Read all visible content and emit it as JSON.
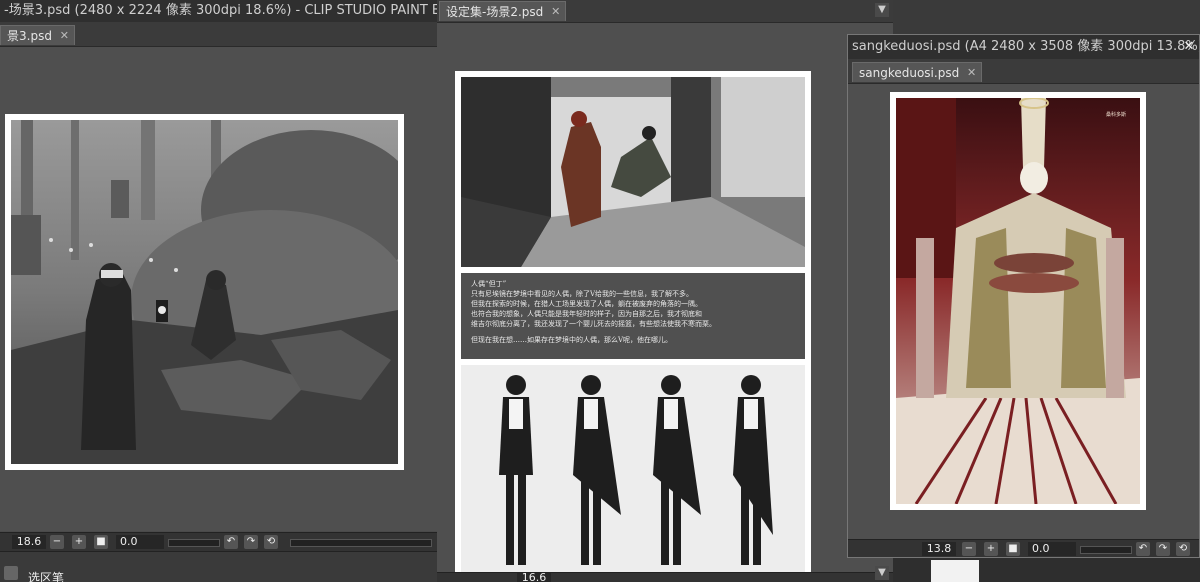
{
  "windows": {
    "left": {
      "title": "-场景3.psd (2480 x 2224 像素 300dpi 18.6%) - CLIP STUDIO PAINT EX",
      "tab": "景3.psd",
      "zoom": "18.6",
      "angle": "0.0",
      "bottom_panel_label": "选区笔"
    },
    "middle": {
      "tab": "设定集-场景2.psd",
      "zoom": "16.6",
      "text_lines": [
        "人偶“但丁”",
        "只有尼埃镜在梦境中看见的人偶，除了V给我的一些信息，我了解不多。",
        "但我在探索的时候，在猎人工场里发现了人偶，躺在被废弃的角落的一隅。",
        "也符合我的想象，人偶只能是我年轻时的样子，因为自那之后，我才彻底和",
        "维吉尔彻底分离了，我还发现了一个婴儿死去的摇篮，有些想法使我不寒而栗。",
        "",
        "但现在我在想……如果存在梦境中的人偶，那么V呢，他在哪儿。"
      ]
    },
    "right": {
      "title": "sangkeduosi.psd (A4 2480 x 3508 像素 300dpi 13.8%)",
      "tab": "sangkeduosi.psd",
      "zoom": "13.8",
      "angle": "0.0",
      "signature": "桑科多斯"
    }
  },
  "icons": {
    "close": "close-icon",
    "zoom_out": "zoom-out-icon",
    "zoom_in": "zoom-in-icon",
    "fit": "fit-icon",
    "rotate_left": "rotate-left-icon",
    "rotate_right": "rotate-right-icon",
    "reset": "reset-rotation-icon",
    "scroll": "chevron-down-icon"
  }
}
